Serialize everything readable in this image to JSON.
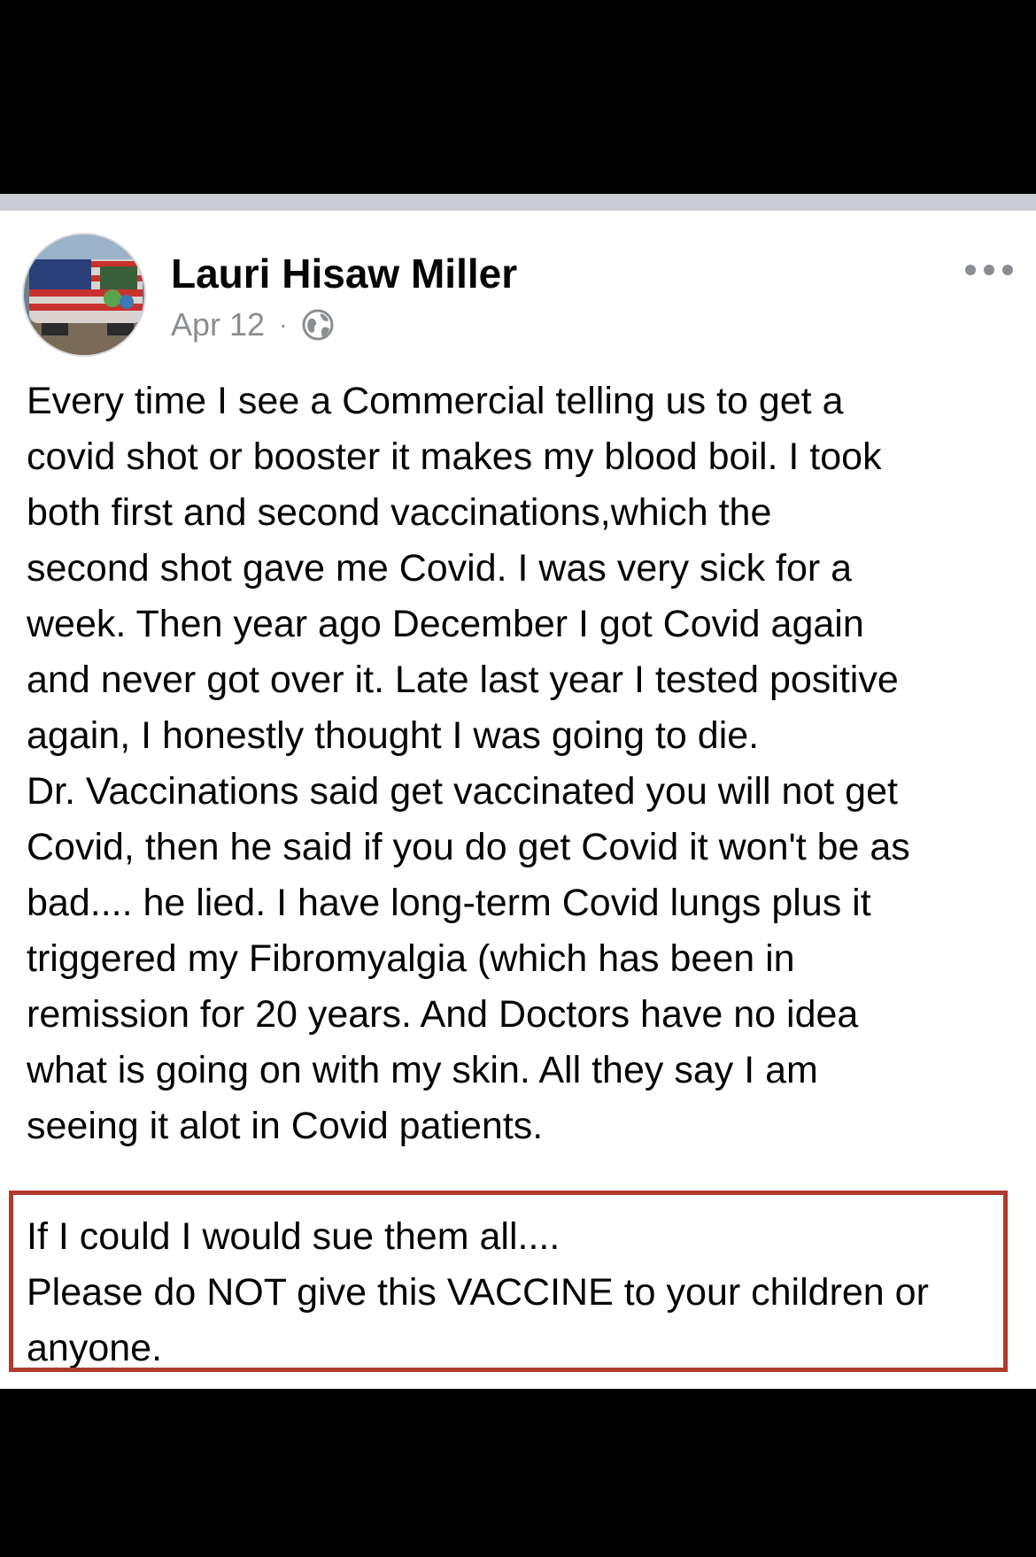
{
  "post": {
    "author": "Lauri Hisaw Miller",
    "date": "Apr 12",
    "separator_dot": "·",
    "privacy_icon": "globe-icon",
    "more_icon": "more-horizontal-icon",
    "body_lines": [
      "Every time I see a Commercial telling us to get a",
      "covid shot or booster it makes my blood boil. I took",
      "both first and second vaccinations,which the",
      "second shot gave me Covid. I was very sick for a",
      "week.  Then year ago December I got Covid again",
      "and never got over it. Late last year I tested positive",
      "again, I honestly thought I was going to die.",
      "Dr. Vaccinations said get vaccinated you will not get",
      "Covid, then he said if you do get Covid it won't be as",
      "bad.... he lied. I have long-term Covid lungs plus it",
      "triggered my Fibromyalgia (which has been in",
      "remission for 20 years. And Doctors have no idea",
      "what is going on with my skin. All they say I am",
      "seeing it alot in Covid patients."
    ],
    "highlighted_lines": [
      "If I  could I would sue them all....",
      "Please do NOT give this VACCINE to your children or",
      "anyone."
    ]
  },
  "colors": {
    "background": "#000000",
    "card": "#ffffff",
    "separator": "#c9ccd1",
    "meta_text": "#8a8d91",
    "highlight_border": "#b03a2e"
  }
}
